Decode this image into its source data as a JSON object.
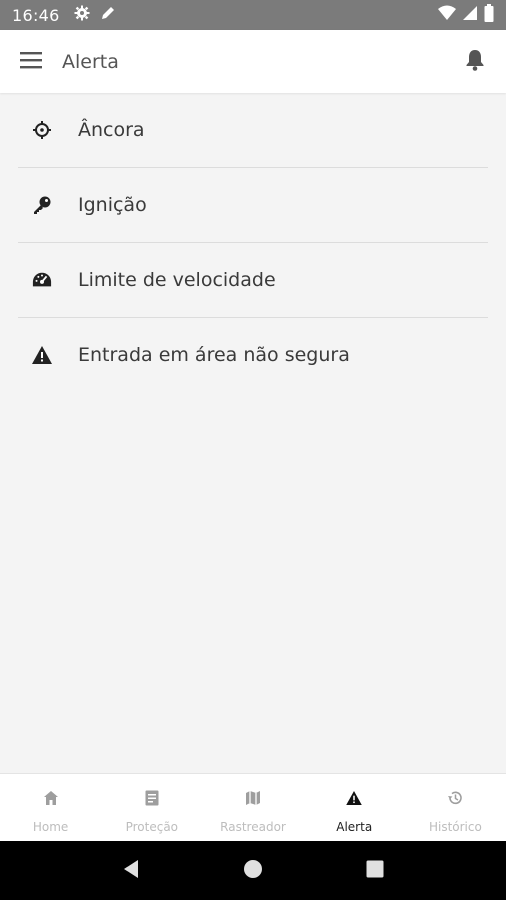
{
  "status_bar": {
    "time": "16:46",
    "left_icons": [
      "gear-icon",
      "pencil-icon"
    ],
    "right_icons": [
      "wifi-icon",
      "signal-icon",
      "battery-icon"
    ]
  },
  "app_bar": {
    "title": "Alerta",
    "menu_icon": "hamburger-menu-icon",
    "action_icon": "bell-icon"
  },
  "alerts": [
    {
      "label": "Âncora",
      "icon": "crosshair-icon"
    },
    {
      "label": "Ignição",
      "icon": "key-icon"
    },
    {
      "label": "Limite de velocidade",
      "icon": "speedometer-icon"
    },
    {
      "label": "Entrada em área não segura",
      "icon": "warning-icon"
    }
  ],
  "bottom_nav": [
    {
      "label": "Home",
      "icon": "home-icon",
      "active": false
    },
    {
      "label": "Proteção",
      "icon": "document-icon",
      "active": false
    },
    {
      "label": "Rastreador",
      "icon": "map-icon",
      "active": false
    },
    {
      "label": "Alerta",
      "icon": "warning-icon",
      "active": true
    },
    {
      "label": "Histórico",
      "icon": "history-icon",
      "active": false
    }
  ],
  "colors": {
    "status_bar": "#7b7b7b",
    "background": "#f4f4f4",
    "active_nav": "#222222",
    "inactive_nav": "#bdbdbd"
  }
}
